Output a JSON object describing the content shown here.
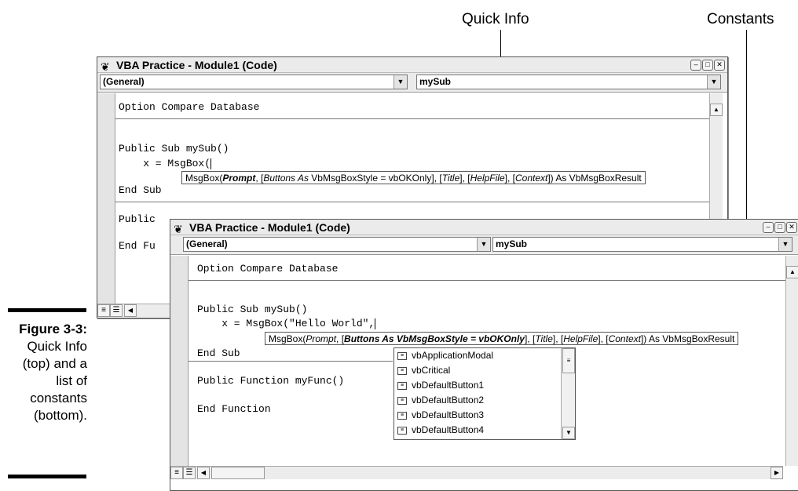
{
  "callouts": {
    "quick_info": "Quick Info",
    "constants": "Constants"
  },
  "caption": {
    "label": "Figure 3-3:",
    "lines": [
      "Quick Info",
      "(top) and a",
      "list of",
      "constants",
      "(bottom)."
    ]
  },
  "window_top": {
    "title": "VBA Practice - Module1 (Code)",
    "object_combo": "(General)",
    "proc_combo": "mySub",
    "lines": [
      "Option Compare Database",
      "Public Sub mySub()",
      "    x = MsgBox(",
      "End Sub",
      "Public ",
      "End Fu"
    ],
    "tip": {
      "pre": "MsgBox(",
      "bold": "Prompt",
      "mid": ", [",
      "buttons": "Buttons As",
      "buttons_type": " VbMsgBoxStyle = vbOKOnly",
      "rest_a": "], [",
      "title": "Title",
      "rest_b": "], [",
      "helpfile": "HelpFile",
      "rest_c": "], [",
      "context": "Context",
      "rest_d": "]) As VbMsgBoxResult"
    }
  },
  "window_bottom": {
    "title": "VBA Practice - Module1 (Code)",
    "object_combo": "(General)",
    "proc_combo": "mySub",
    "lines": [
      "Option Compare Database",
      "Public Sub mySub()",
      "    x = MsgBox(\"Hello World\",",
      "End Sub",
      "Public Function myFunc()",
      "End Function"
    ],
    "tip": {
      "pre": "MsgBox(",
      "prompt": "Prompt",
      "mid": ", [",
      "buttons": "Buttons As VbMsgBoxStyle = vbOKOnly",
      "rest_a": "], [",
      "title": "Title",
      "rest_b": "], [",
      "helpfile": "HelpFile",
      "rest_c": "], [",
      "context": "Context",
      "rest_d": "]) As VbMsgBoxResult"
    },
    "constants": [
      "vbApplicationModal",
      "vbCritical",
      "vbDefaultButton1",
      "vbDefaultButton2",
      "vbDefaultButton3",
      "vbDefaultButton4"
    ]
  }
}
